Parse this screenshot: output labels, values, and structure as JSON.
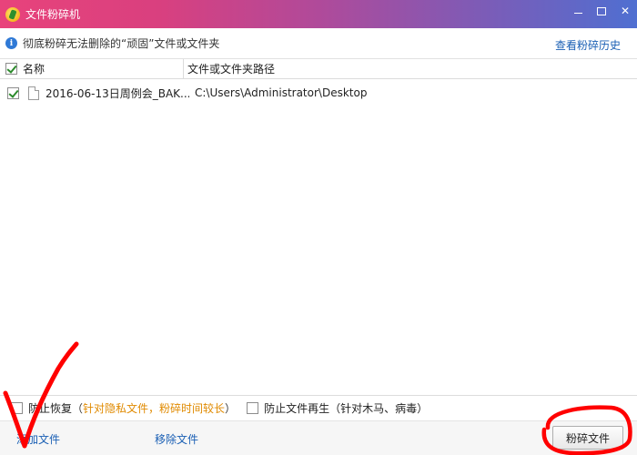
{
  "window": {
    "title": "文件粉碎机",
    "controls": {
      "minimize": "",
      "maximize": "",
      "close": "✕"
    }
  },
  "infobar": {
    "icon": "info-icon",
    "text": "彻底粉碎无法删除的“顽固”文件或文件夹",
    "history_link": "查看粉碎历史"
  },
  "table": {
    "columns": [
      "名称",
      "文件或文件夹路径"
    ],
    "rows": [
      {
        "checked": true,
        "name": "2016-06-13日周例会_BAK...",
        "path": "C:\\Users\\Administrator\\Desktop"
      }
    ]
  },
  "options": {
    "prevent_recovery": {
      "label": "防止恢复",
      "paren_open": "（",
      "note": "针对隐私文件，粉碎时间较长",
      "paren_close": "）"
    },
    "prevent_regen": {
      "label": "防止文件再生（针对木马、病毒）"
    }
  },
  "bottom": {
    "add_file": "添加文件",
    "remove_file": "移除文件",
    "shred_button": "粉碎文件"
  },
  "colors": {
    "title_gradient_start": "#e8437b",
    "title_gradient_end": "#4f6fd1",
    "link": "#1a5fb4",
    "note_orange": "#e08a00",
    "annotation_red": "#ff0000"
  }
}
